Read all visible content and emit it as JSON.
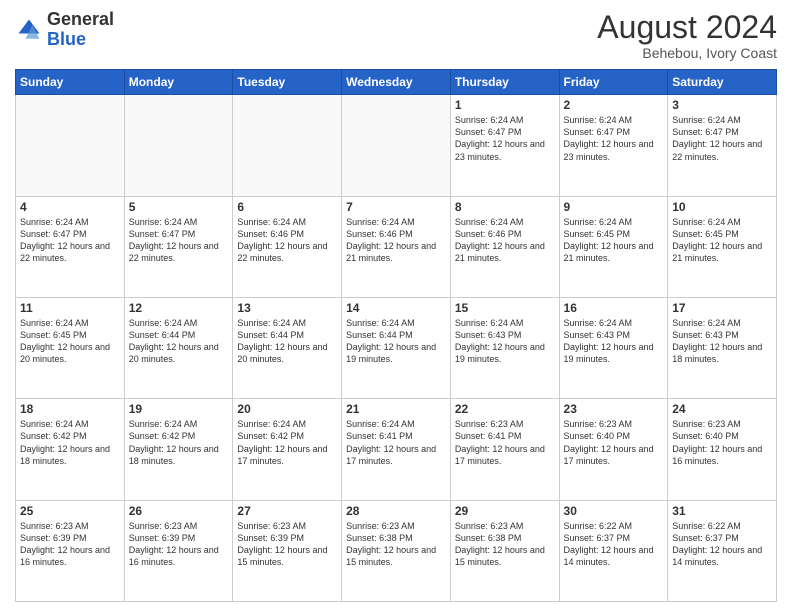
{
  "header": {
    "logo_general": "General",
    "logo_blue": "Blue",
    "month_year": "August 2024",
    "location": "Behebou, Ivory Coast"
  },
  "days_of_week": [
    "Sunday",
    "Monday",
    "Tuesday",
    "Wednesday",
    "Thursday",
    "Friday",
    "Saturday"
  ],
  "weeks": [
    [
      {
        "day": "",
        "info": ""
      },
      {
        "day": "",
        "info": ""
      },
      {
        "day": "",
        "info": ""
      },
      {
        "day": "",
        "info": ""
      },
      {
        "day": "1",
        "info": "Sunrise: 6:24 AM\nSunset: 6:47 PM\nDaylight: 12 hours and 23 minutes."
      },
      {
        "day": "2",
        "info": "Sunrise: 6:24 AM\nSunset: 6:47 PM\nDaylight: 12 hours and 23 minutes."
      },
      {
        "day": "3",
        "info": "Sunrise: 6:24 AM\nSunset: 6:47 PM\nDaylight: 12 hours and 22 minutes."
      }
    ],
    [
      {
        "day": "4",
        "info": "Sunrise: 6:24 AM\nSunset: 6:47 PM\nDaylight: 12 hours and 22 minutes."
      },
      {
        "day": "5",
        "info": "Sunrise: 6:24 AM\nSunset: 6:47 PM\nDaylight: 12 hours and 22 minutes."
      },
      {
        "day": "6",
        "info": "Sunrise: 6:24 AM\nSunset: 6:46 PM\nDaylight: 12 hours and 22 minutes."
      },
      {
        "day": "7",
        "info": "Sunrise: 6:24 AM\nSunset: 6:46 PM\nDaylight: 12 hours and 21 minutes."
      },
      {
        "day": "8",
        "info": "Sunrise: 6:24 AM\nSunset: 6:46 PM\nDaylight: 12 hours and 21 minutes."
      },
      {
        "day": "9",
        "info": "Sunrise: 6:24 AM\nSunset: 6:45 PM\nDaylight: 12 hours and 21 minutes."
      },
      {
        "day": "10",
        "info": "Sunrise: 6:24 AM\nSunset: 6:45 PM\nDaylight: 12 hours and 21 minutes."
      }
    ],
    [
      {
        "day": "11",
        "info": "Sunrise: 6:24 AM\nSunset: 6:45 PM\nDaylight: 12 hours and 20 minutes."
      },
      {
        "day": "12",
        "info": "Sunrise: 6:24 AM\nSunset: 6:44 PM\nDaylight: 12 hours and 20 minutes."
      },
      {
        "day": "13",
        "info": "Sunrise: 6:24 AM\nSunset: 6:44 PM\nDaylight: 12 hours and 20 minutes."
      },
      {
        "day": "14",
        "info": "Sunrise: 6:24 AM\nSunset: 6:44 PM\nDaylight: 12 hours and 19 minutes."
      },
      {
        "day": "15",
        "info": "Sunrise: 6:24 AM\nSunset: 6:43 PM\nDaylight: 12 hours and 19 minutes."
      },
      {
        "day": "16",
        "info": "Sunrise: 6:24 AM\nSunset: 6:43 PM\nDaylight: 12 hours and 19 minutes."
      },
      {
        "day": "17",
        "info": "Sunrise: 6:24 AM\nSunset: 6:43 PM\nDaylight: 12 hours and 18 minutes."
      }
    ],
    [
      {
        "day": "18",
        "info": "Sunrise: 6:24 AM\nSunset: 6:42 PM\nDaylight: 12 hours and 18 minutes."
      },
      {
        "day": "19",
        "info": "Sunrise: 6:24 AM\nSunset: 6:42 PM\nDaylight: 12 hours and 18 minutes."
      },
      {
        "day": "20",
        "info": "Sunrise: 6:24 AM\nSunset: 6:42 PM\nDaylight: 12 hours and 17 minutes."
      },
      {
        "day": "21",
        "info": "Sunrise: 6:24 AM\nSunset: 6:41 PM\nDaylight: 12 hours and 17 minutes."
      },
      {
        "day": "22",
        "info": "Sunrise: 6:23 AM\nSunset: 6:41 PM\nDaylight: 12 hours and 17 minutes."
      },
      {
        "day": "23",
        "info": "Sunrise: 6:23 AM\nSunset: 6:40 PM\nDaylight: 12 hours and 17 minutes."
      },
      {
        "day": "24",
        "info": "Sunrise: 6:23 AM\nSunset: 6:40 PM\nDaylight: 12 hours and 16 minutes."
      }
    ],
    [
      {
        "day": "25",
        "info": "Sunrise: 6:23 AM\nSunset: 6:39 PM\nDaylight: 12 hours and 16 minutes."
      },
      {
        "day": "26",
        "info": "Sunrise: 6:23 AM\nSunset: 6:39 PM\nDaylight: 12 hours and 16 minutes."
      },
      {
        "day": "27",
        "info": "Sunrise: 6:23 AM\nSunset: 6:39 PM\nDaylight: 12 hours and 15 minutes."
      },
      {
        "day": "28",
        "info": "Sunrise: 6:23 AM\nSunset: 6:38 PM\nDaylight: 12 hours and 15 minutes."
      },
      {
        "day": "29",
        "info": "Sunrise: 6:23 AM\nSunset: 6:38 PM\nDaylight: 12 hours and 15 minutes."
      },
      {
        "day": "30",
        "info": "Sunrise: 6:22 AM\nSunset: 6:37 PM\nDaylight: 12 hours and 14 minutes."
      },
      {
        "day": "31",
        "info": "Sunrise: 6:22 AM\nSunset: 6:37 PM\nDaylight: 12 hours and 14 minutes."
      }
    ]
  ]
}
